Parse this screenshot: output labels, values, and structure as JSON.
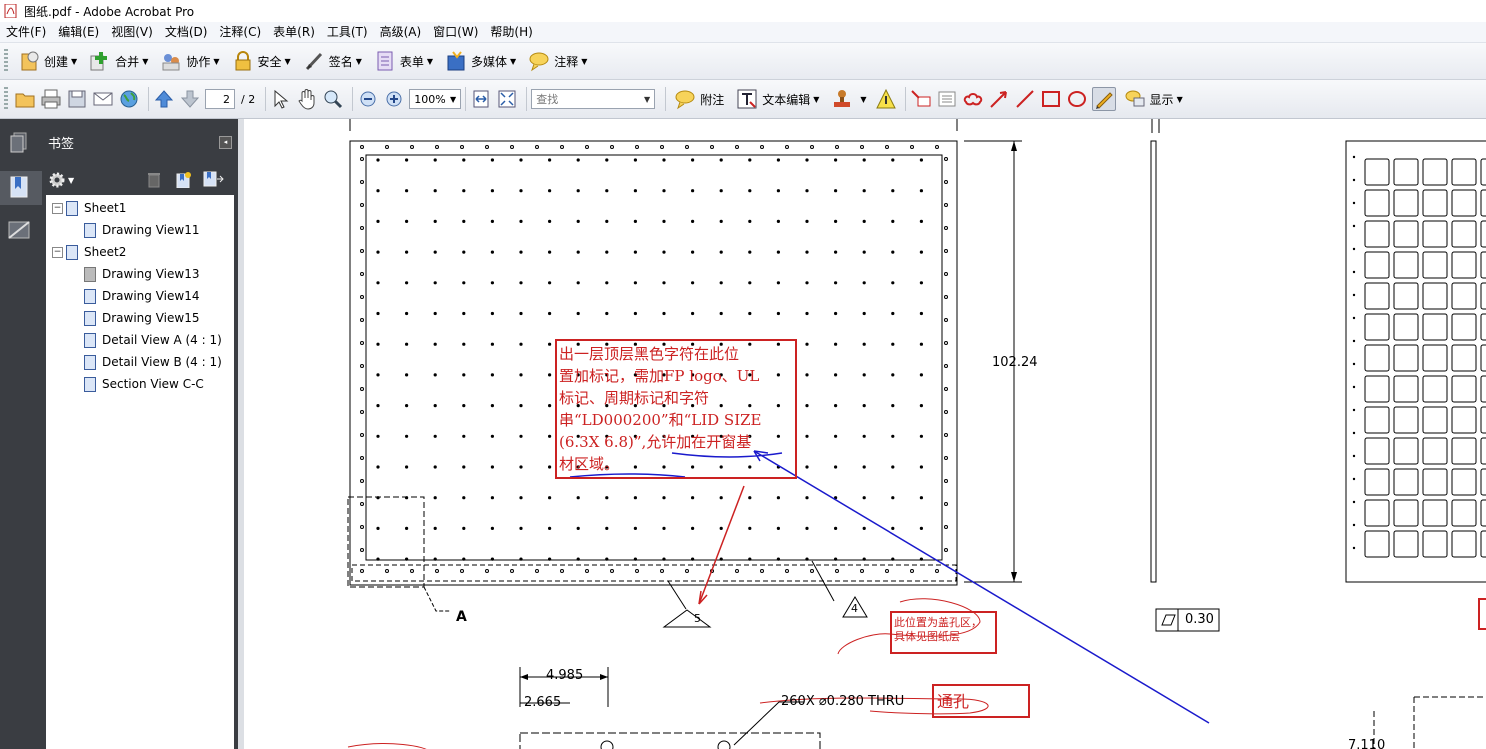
{
  "window": {
    "title": "图纸.pdf - Adobe Acrobat Pro"
  },
  "menu": [
    "文件(F)",
    "编辑(E)",
    "视图(V)",
    "文档(D)",
    "注释(C)",
    "表单(R)",
    "工具(T)",
    "高级(A)",
    "窗口(W)",
    "帮助(H)"
  ],
  "toolbar1": [
    "创建",
    "合并",
    "协作",
    "安全",
    "签名",
    "表单",
    "多媒体",
    "注释"
  ],
  "toolbar2": {
    "page_current": "2",
    "page_total": "/ 2",
    "zoom": "100%",
    "find_placeholder": "查找",
    "note_label": "附注",
    "text_edit_label": "文本编辑",
    "show_label": "显示"
  },
  "panel": {
    "title": "书签",
    "bookmarks": [
      {
        "label": "Sheet1"
      },
      {
        "label": "Drawing View11"
      },
      {
        "label": "Sheet2"
      },
      {
        "label": "Drawing View13"
      },
      {
        "label": "Drawing View14"
      },
      {
        "label": "Drawing View15"
      },
      {
        "label": "Detail View A (4 : 1)"
      },
      {
        "label": "Detail View B (4 : 1)"
      },
      {
        "label": "Section View C-C"
      }
    ]
  },
  "drawing": {
    "dim_height": "102.24",
    "balloon_5": "5",
    "balloon_4": "4",
    "detail_label": "A",
    "flatness": "0.30",
    "dim_4985": "4.985",
    "dim_2665": "2.665",
    "hole_note": "260X ⌀0.280 THRU",
    "dim_7110": "7.110"
  },
  "annotations": {
    "main_note_lines": [
      "出一层顶层黑色字符在此位",
      "置加标记，需加FP logo、UL",
      "标记、周期标记和字符",
      "串“LD000200”和“LID SIZE",
      "(6.3X 6.8)”,允许加在开窗基",
      "材区域。"
    ],
    "note_small_lines": [
      "此位置为盖孔区，",
      "具体见图纸层"
    ],
    "note_hole": "通孔"
  },
  "colors": {
    "annotation_red": "#cc2222",
    "annotation_blue": "#1a1acc",
    "panel_dark": "#3a3d42"
  }
}
